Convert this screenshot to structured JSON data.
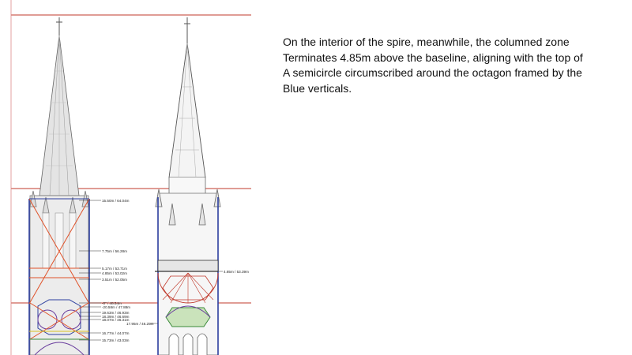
{
  "caption": {
    "lines": [
      "On the interior of the spire, meanwhile, the columned zone",
      "Terminates 4.85m above the baseline, aligning with the top of",
      "A semicircle circumscribed around the octagon framed by the",
      "Blue verticals."
    ]
  },
  "diagram": {
    "measurements": [
      "15.50m / 64.04m",
      "7.75m / 56.28m",
      "5.17m / 53.71m",
      "4.85m / 53.02m",
      "3.51m / 52.05m",
      "-0\" / 48.54m",
      "-20.58m / 47.88m",
      "19.63m / 46.93m",
      "18.39m / 46.69m",
      "18.07m / 46.31m",
      "16.77m / 44.07m",
      "15.73m / 43.03m"
    ],
    "right_measurements": [
      "4.85m / 53.39m",
      "17.95m / 46.25m"
    ],
    "colors": {
      "reference_line": "#c0392b",
      "vertical_frame": "#2c3e9e",
      "cross_lines": "#e0522a",
      "octagon_fill": "#a6d38a",
      "drawing_line": "#555555"
    }
  }
}
